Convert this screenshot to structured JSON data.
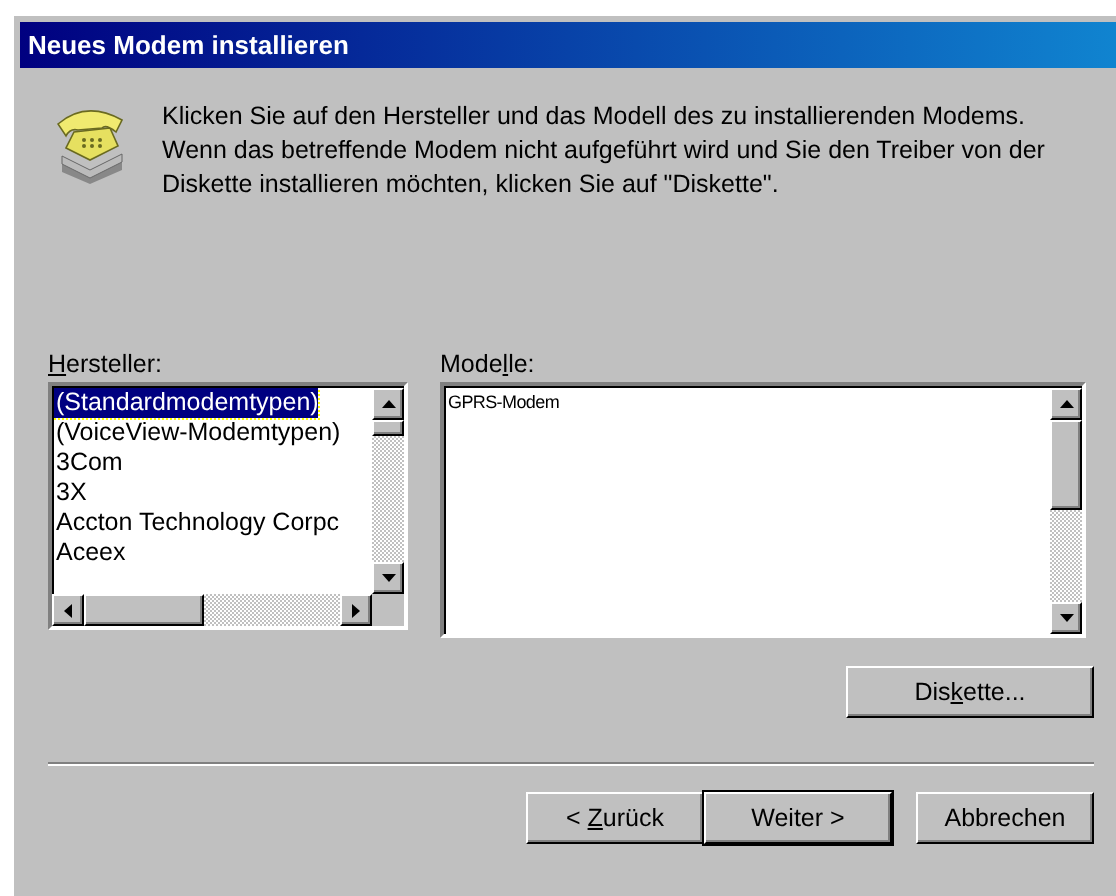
{
  "window": {
    "title": "Neues Modem installieren"
  },
  "instructions": "Klicken Sie auf den Hersteller und das Modell des zu installierenden Modems. Wenn das betreffende Modem nicht aufgeführt wird und Sie den Treiber von der Diskette installieren möchten, klicken Sie auf \"Diskette\".",
  "manufacturers": {
    "label": {
      "key": "H",
      "after": "ersteller:"
    },
    "items": [
      {
        "text": "(Standardmodemtypen)",
        "selected": true
      },
      {
        "text": "(VoiceView-Modemtypen)",
        "selected": false
      },
      {
        "text": "3Com",
        "selected": false
      },
      {
        "text": "3X",
        "selected": false
      },
      {
        "text": "Accton Technology Corpc",
        "selected": false
      },
      {
        "text": "Aceex",
        "selected": false
      }
    ]
  },
  "models": {
    "label": {
      "before": "Mode",
      "key": "l",
      "after": "le:"
    },
    "items": [
      {
        "text": "GPRS-Modem",
        "selected": false
      }
    ]
  },
  "disk_button": {
    "before": "Dis",
    "key": "k",
    "after": "ette..."
  },
  "buttons": [
    {
      "before": "< ",
      "key": "Z",
      "after": "urück",
      "default": false
    },
    {
      "before": "Weiter >",
      "default": true
    },
    {
      "before": "Abbrechen",
      "default": false
    }
  ]
}
